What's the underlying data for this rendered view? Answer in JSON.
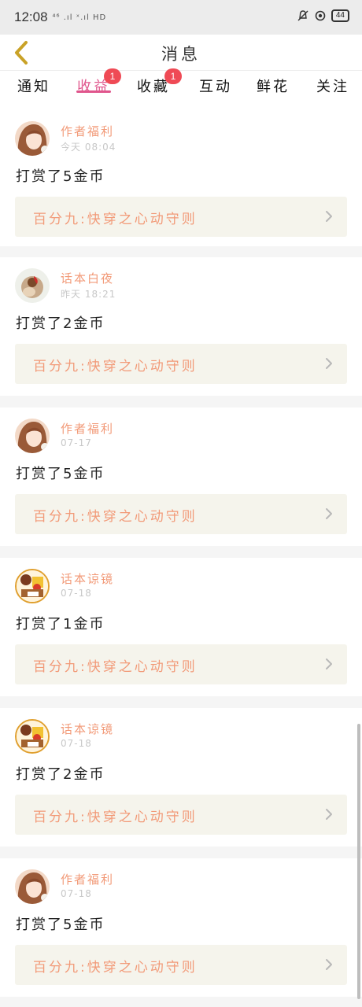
{
  "status_bar": {
    "time": "12:08",
    "signal_text": "⁴⁶ .ıl ˣ.ıl HD",
    "battery": "44",
    "icons": [
      "mute-bell-icon",
      "alarm-icon",
      "battery-icon"
    ]
  },
  "header": {
    "title": "消息",
    "back_icon": "chevron-left-icon",
    "back_color": "#c9a227"
  },
  "tabs": [
    {
      "label": "通知",
      "badge": ""
    },
    {
      "label": "收益",
      "badge": "1"
    },
    {
      "label": "收藏",
      "badge": "1"
    },
    {
      "label": "互动",
      "badge": ""
    },
    {
      "label": "鲜花",
      "badge": ""
    },
    {
      "label": "关注",
      "badge": ""
    }
  ],
  "active_tab": "收益",
  "colors": {
    "accent": "#e0558c",
    "badge": "#ef4a55",
    "author": "#f29a78",
    "link_bg": "#f5f4ec"
  },
  "messages": [
    {
      "author": "作者福利",
      "time": "今天 08:04",
      "text": "打赏了5金币",
      "book": "百分九:快穿之心动守则",
      "avatar": "girl-avatar"
    },
    {
      "author": "话本白夜",
      "time": "昨天 18:21",
      "text": "打赏了2金币",
      "book": "百分九:快穿之心动守则",
      "avatar": "rose-avatar"
    },
    {
      "author": "作者福利",
      "time": "07-17",
      "text": "打赏了5金币",
      "book": "百分九:快穿之心动守则",
      "avatar": "girl-avatar"
    },
    {
      "author": "话本谅镜",
      "time": "07-18",
      "text": "打赏了1金币",
      "book": "百分九:快穿之心动守则",
      "avatar": "gift-avatar"
    },
    {
      "author": "话本谅镜",
      "time": "07-18",
      "text": "打赏了2金币",
      "book": "百分九:快穿之心动守则",
      "avatar": "gift-avatar"
    },
    {
      "author": "作者福利",
      "time": "07-18",
      "text": "打赏了5金币",
      "book": "百分九:快穿之心动守则",
      "avatar": "girl-avatar"
    }
  ]
}
